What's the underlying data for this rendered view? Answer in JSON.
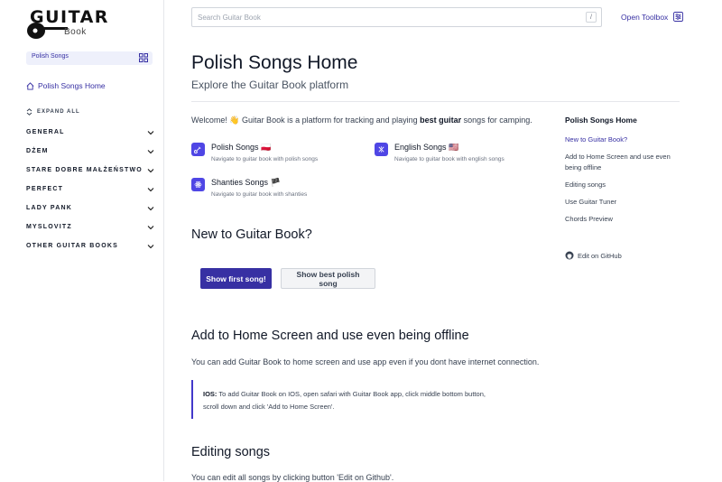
{
  "logo": {
    "word": "GUITAR",
    "sub": "Book"
  },
  "sidebar": {
    "selector_label": "Polish Songs",
    "home_link": "Polish Songs Home",
    "expand_all": "EXPAND ALL",
    "items": [
      "GENERAL",
      "DŻEM",
      "STARE DOBRE MAŁŻEŃSTWO",
      "PERFECT",
      "LADY PANK",
      "MYSLOVITZ",
      "OTHER GUITAR BOOKS"
    ]
  },
  "header": {
    "search_placeholder": "Search Guitar Book",
    "search_shortcut": "/",
    "toolbox_label": "Open Toolbox"
  },
  "main": {
    "title": "Polish Songs Home",
    "subtitle": "Explore the Guitar Book platform",
    "welcome": {
      "part1": "Welcome! 👋 Guitar Book is a platform for tracking and playing ",
      "bold": "best guitar",
      "part2": " songs for camping."
    },
    "cards": [
      {
        "title": "Polish Songs 🇵🇱",
        "desc": "Navigate to guitar book with polish songs"
      },
      {
        "title": "English Songs 🇺🇸",
        "desc": "Navigate to guitar book with english songs"
      },
      {
        "title": "Shanties Songs 🏴",
        "desc": "Navigate to guitar book with shanties"
      }
    ],
    "section_new": "New to Guitar Book?",
    "btn_first": "Show first song!",
    "btn_best": "Show best polish song",
    "section_home": "Add to Home Screen and use even being offline",
    "home_para": "You can add Guitar Book to home screen and use app even if you dont have internet connection.",
    "callout": {
      "label": "IOS:",
      "line1": " To add Guitar Book on IOS, open safari with Guitar Book app, click middle bottom button,",
      "line2": "scroll down and click 'Add to Home Screen'."
    },
    "section_editing": "Editing songs",
    "editing_para": "You can edit all songs by clicking button 'Edit on Github'."
  },
  "toc": {
    "title": "Polish Songs Home",
    "items": [
      "New to Guitar Book?",
      "Add to Home Screen and use even being offline",
      "Editing songs",
      "Use Guitar Tuner",
      "Chords Preview"
    ],
    "github": "Edit on GitHub"
  },
  "colors": {
    "accent": "#3730a3",
    "icon_bg": "#4f46e5"
  }
}
